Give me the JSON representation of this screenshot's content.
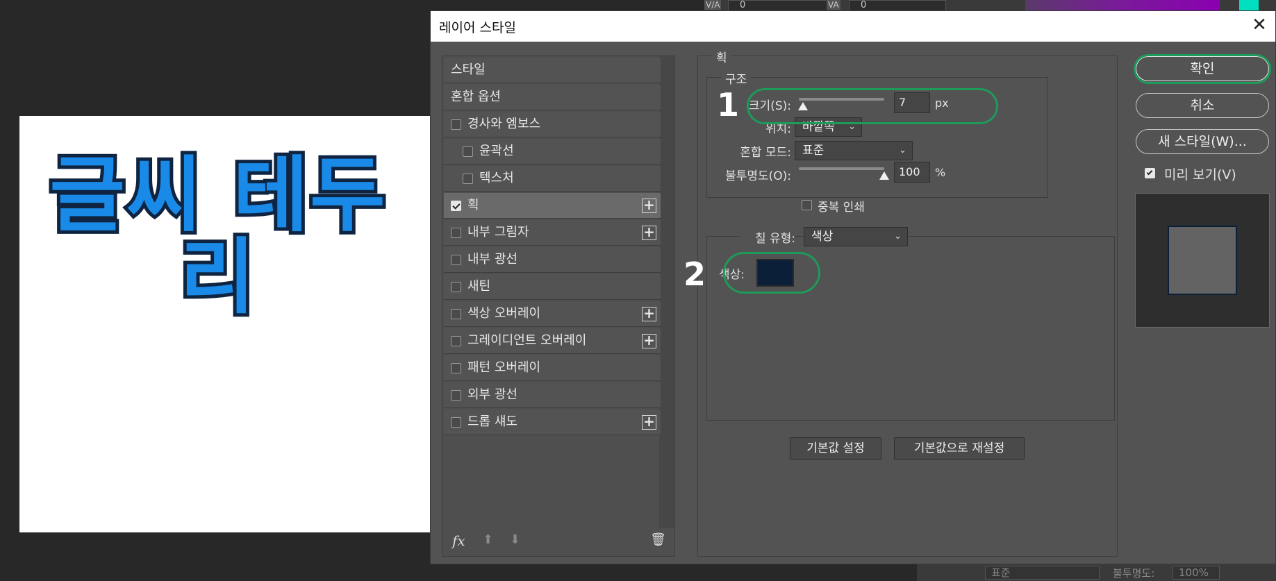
{
  "background": {
    "toolbar": {
      "field1": "0",
      "field2": "0",
      "icon1": "V/A",
      "icon2": "VA"
    },
    "canvas_text": "글씨 테두리",
    "bottom": {
      "blend": "표준",
      "opacity_label": "불투명도:",
      "opacity_value": "100%"
    },
    "colors": {
      "canvas": "#ffffff",
      "text_fill": "#1a8ae8",
      "text_stroke": "#0e2440",
      "swatch": "#0b1f38",
      "highlight": "#1e9a5a"
    }
  },
  "dialog": {
    "title": "레이어 스타일",
    "close_icon": "close-icon",
    "styles": [
      {
        "label": "스타일",
        "checkbox": false,
        "has_checkbox": false,
        "plus": false,
        "indent": false,
        "selected": false
      },
      {
        "label": "혼합 옵션",
        "checkbox": false,
        "has_checkbox": false,
        "plus": false,
        "indent": false,
        "selected": false
      },
      {
        "label": "경사와 엠보스",
        "checkbox": false,
        "has_checkbox": true,
        "plus": false,
        "indent": false,
        "selected": false
      },
      {
        "label": "윤곽선",
        "checkbox": false,
        "has_checkbox": true,
        "plus": false,
        "indent": true,
        "selected": false
      },
      {
        "label": "텍스처",
        "checkbox": false,
        "has_checkbox": true,
        "plus": false,
        "indent": true,
        "selected": false
      },
      {
        "label": "획",
        "checkbox": true,
        "has_checkbox": true,
        "plus": true,
        "indent": false,
        "selected": true
      },
      {
        "label": "내부 그림자",
        "checkbox": false,
        "has_checkbox": true,
        "plus": true,
        "indent": false,
        "selected": false
      },
      {
        "label": "내부 광선",
        "checkbox": false,
        "has_checkbox": true,
        "plus": false,
        "indent": false,
        "selected": false
      },
      {
        "label": "새틴",
        "checkbox": false,
        "has_checkbox": true,
        "plus": false,
        "indent": false,
        "selected": false
      },
      {
        "label": "색상 오버레이",
        "checkbox": false,
        "has_checkbox": true,
        "plus": true,
        "indent": false,
        "selected": false
      },
      {
        "label": "그레이디언트 오버레이",
        "checkbox": false,
        "has_checkbox": true,
        "plus": true,
        "indent": false,
        "selected": false
      },
      {
        "label": "패턴 오버레이",
        "checkbox": false,
        "has_checkbox": true,
        "plus": false,
        "indent": false,
        "selected": false
      },
      {
        "label": "외부 광선",
        "checkbox": false,
        "has_checkbox": true,
        "plus": false,
        "indent": false,
        "selected": false
      },
      {
        "label": "드롭 섀도",
        "checkbox": false,
        "has_checkbox": true,
        "plus": true,
        "indent": false,
        "selected": false
      }
    ],
    "footer": {
      "fx": "fx",
      "up_icon": "arrow-up-icon",
      "down_icon": "arrow-down-icon",
      "trash_icon": "trash-icon"
    },
    "stroke": {
      "section_title": "획",
      "structure_title": "구조",
      "size_label": "크기(S):",
      "size_value": "7",
      "size_unit": "px",
      "size_slider": 0.05,
      "position_label": "위치:",
      "position_value": "바깥쪽",
      "blend_label": "혼합 모드:",
      "blend_value": "표준",
      "opacity_label": "불투명도(O):",
      "opacity_value": "100",
      "opacity_unit": "%",
      "opacity_slider": 1.0,
      "overprint_label": "중복 인쇄",
      "fill_type_label": "칠 유형:",
      "fill_type_value": "색상",
      "color_label": "색상:",
      "default_btn": "기본값 설정",
      "reset_btn": "기본값으로 재설정",
      "annotation_1": "1",
      "annotation_2": "2"
    },
    "actions": {
      "ok": "확인",
      "cancel": "취소",
      "new_style": "새 스타일(W)...",
      "preview_label": "미리 보기(V)",
      "preview_checked": true
    }
  }
}
